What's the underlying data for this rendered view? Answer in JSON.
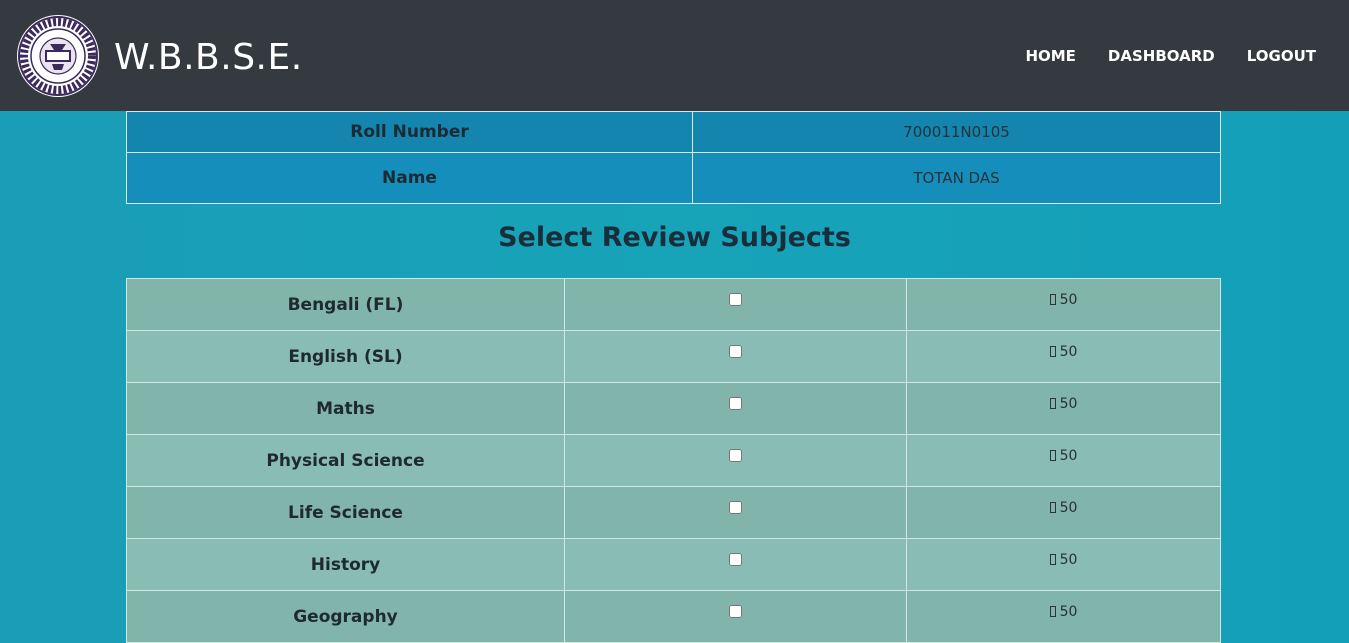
{
  "header": {
    "brand": "W.B.B.S.E.",
    "logo_icon": "wbbse-seal-icon",
    "nav": [
      {
        "label": "HOME"
      },
      {
        "label": "DASHBOARD"
      },
      {
        "label": "LOGOUT"
      }
    ]
  },
  "student": {
    "rows": [
      {
        "label": "Roll Number",
        "value": "700011N0105"
      },
      {
        "label": "Name",
        "value": "TOTAN DAS"
      }
    ]
  },
  "review": {
    "title": "Select Review Subjects",
    "currency_icon": "rupee-icon",
    "subjects": [
      {
        "name": "Bengali (FL)",
        "fee": "50",
        "checked": false
      },
      {
        "name": "English (SL)",
        "fee": "50",
        "checked": false
      },
      {
        "name": "Maths",
        "fee": "50",
        "checked": false
      },
      {
        "name": "Physical Science",
        "fee": "50",
        "checked": false
      },
      {
        "name": "Life Science",
        "fee": "50",
        "checked": false
      },
      {
        "name": "History",
        "fee": "50",
        "checked": false
      },
      {
        "name": "Geography",
        "fee": "50",
        "checked": false
      }
    ]
  },
  "colors": {
    "navbar": "#343a40",
    "background": "#17a2b8",
    "row_dark": "#81b4ab",
    "row_light": "#89bcb4"
  }
}
